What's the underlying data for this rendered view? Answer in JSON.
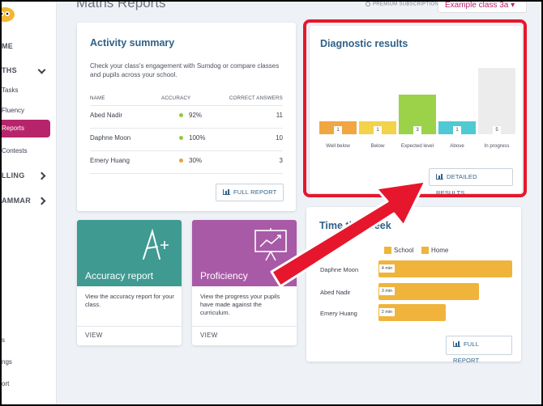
{
  "app": {
    "page_title": "Maths Reports",
    "premium_label": "PREMIUM SUBSCRIPTION",
    "class_select": "Example class 3a ▾"
  },
  "colors": {
    "brand": "#b8246b",
    "title_blue": "#2f6189",
    "accuracy_teal": "#3f9a92",
    "proficiency_purple": "#a85aa7",
    "highlight_red": "#e6172c",
    "time_bar": "#f0b43c"
  },
  "sidebar": {
    "items": [
      {
        "label": "ME",
        "kind": "sec"
      },
      {
        "label": "THS",
        "kind": "sec",
        "chevron": "down"
      },
      {
        "label": "Tasks",
        "kind": "sub"
      },
      {
        "label": "Fluency",
        "kind": "sub"
      },
      {
        "label": "Reports",
        "kind": "sub",
        "active": true
      },
      {
        "label": "Contests",
        "kind": "sub"
      },
      {
        "label": "LLING",
        "kind": "sec",
        "chevron": "right"
      },
      {
        "label": "AMMAR",
        "kind": "sec",
        "chevron": "right"
      },
      {
        "label": "s",
        "kind": "sub"
      },
      {
        "label": "ngs",
        "kind": "sub"
      },
      {
        "label": "ort",
        "kind": "sub"
      }
    ]
  },
  "activity": {
    "title": "Activity summary",
    "description": "Check your class's engagement with Sumdog or compare classes and pupils across your school.",
    "columns": {
      "name": "NAME",
      "accuracy": "ACCURACY",
      "correct": "CORRECT ANSWERS"
    },
    "rows": [
      {
        "name": "Abed Nadir",
        "accuracy": "92%",
        "dot": "#8fcc3a",
        "correct": "11"
      },
      {
        "name": "Daphne Moon",
        "accuracy": "100%",
        "dot": "#8fcc3a",
        "correct": "10"
      },
      {
        "name": "Emery Huang",
        "accuracy": "30%",
        "dot": "#e9a13a",
        "correct": "3"
      }
    ],
    "button": "FULL REPORT"
  },
  "tiles": [
    {
      "name": "Accuracy report",
      "description": "View the accuracy report for your class.",
      "view": "VIEW",
      "icon": "a-plus-icon"
    },
    {
      "name": "Proficiency",
      "description": "View the progress your pupils have made against the curriculum.",
      "view": "VIEW",
      "icon": "chart-board-icon"
    }
  ],
  "diagnostic": {
    "title": "Diagnostic results",
    "button": "DETAILED RESULTS",
    "chart_data": {
      "type": "bar",
      "categories": [
        "Well below",
        "Below",
        "Expected level",
        "Above",
        "In progress"
      ],
      "values": [
        1,
        1,
        3,
        1,
        5
      ],
      "colors": [
        "#f0a742",
        "#f2d34a",
        "#9bd24a",
        "#4fcad2",
        "#ececec"
      ],
      "ylim": [
        0,
        5
      ]
    }
  },
  "time": {
    "title": "Time this week",
    "legend": [
      {
        "label": "School",
        "color": "#f0b43c"
      },
      {
        "label": "Home",
        "color": "#f0b43c"
      }
    ],
    "chart_data": {
      "type": "bar",
      "categories": [
        "Daphne Moon",
        "Abed Nadir",
        "Emery Huang"
      ],
      "values": [
        4,
        3,
        2
      ],
      "labels": [
        "4 min",
        "3 min",
        "2 min"
      ],
      "xlim": [
        0,
        4
      ]
    },
    "button": "FULL REPORT"
  }
}
